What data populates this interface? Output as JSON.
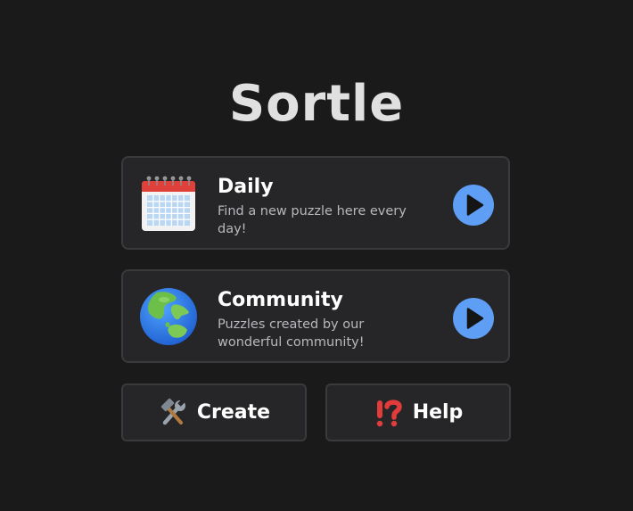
{
  "app": {
    "title": "Sortle"
  },
  "modes": {
    "daily": {
      "heading": "Daily",
      "description": "Find a new puzzle here every day!",
      "icon": "calendar-icon",
      "action_icon": "play-icon"
    },
    "community": {
      "heading": "Community",
      "description": "Puzzles created by our wonderful community!",
      "icon": "globe-icon",
      "action_icon": "play-icon"
    }
  },
  "actions": {
    "create": {
      "label": "Create",
      "icon": "hammer-wrench-icon"
    },
    "help": {
      "label": "Help",
      "icon": "exclamation-question-icon"
    }
  },
  "colors": {
    "background": "#1a1a1b",
    "card": "#262628",
    "border": "#3a3a3c",
    "accent": "#5e9ef5"
  }
}
